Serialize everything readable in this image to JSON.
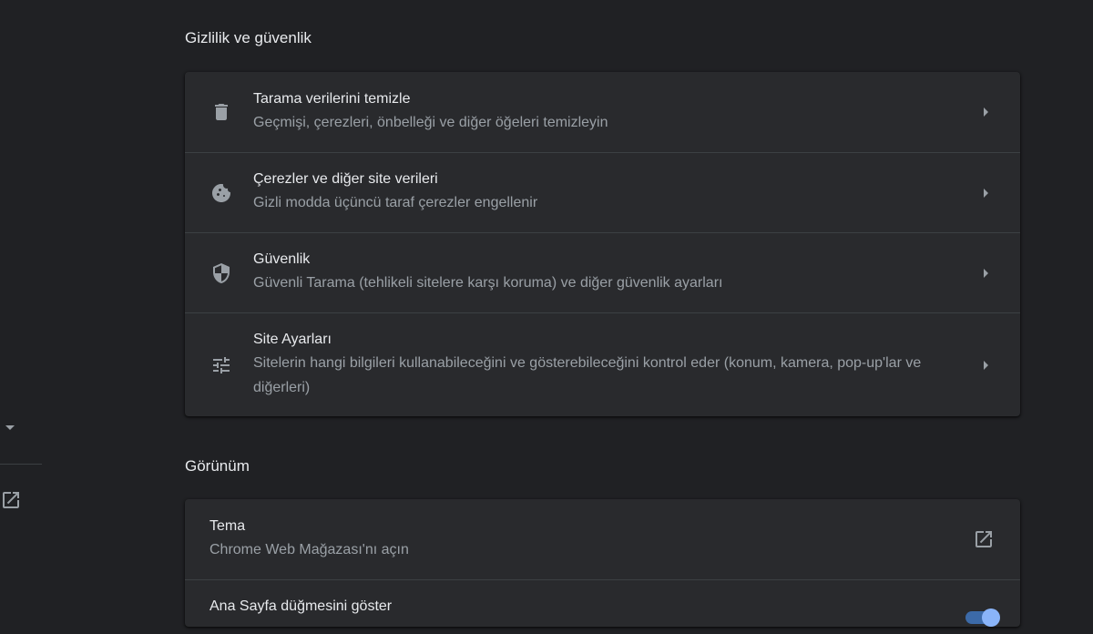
{
  "privacy": {
    "title": "Gizlilik ve güvenlik",
    "rows": [
      {
        "icon": "trash-icon",
        "label": "Tarama verilerini temizle",
        "sublabel": "Geçmişi, çerezleri, önbelleği ve diğer öğeleri temizleyin"
      },
      {
        "icon": "cookie-icon",
        "label": "Çerezler ve diğer site verileri",
        "sublabel": "Gizli modda üçüncü taraf çerezler engellenir"
      },
      {
        "icon": "shield-icon",
        "label": "Güvenlik",
        "sublabel": "Güvenli Tarama (tehlikeli sitelere karşı koruma) ve diğer güvenlik ayarları"
      },
      {
        "icon": "tune-icon",
        "label": "Site Ayarları",
        "sublabel": "Sitelerin hangi bilgileri kullanabileceğini ve gösterebileceğini kontrol eder (konum, kamera, pop-up'lar ve diğerleri)"
      }
    ]
  },
  "appearance": {
    "title": "Görünüm",
    "rows": [
      {
        "label": "Tema",
        "sublabel": "Chrome Web Mağazası'nı açın",
        "icon": "open-in-new-icon"
      },
      {
        "label": "Ana Sayfa düğmesini göster",
        "toggle_on": true
      }
    ]
  },
  "colors": {
    "background": "#202124",
    "card": "#292a2d",
    "accent": "#8ab4f8"
  }
}
